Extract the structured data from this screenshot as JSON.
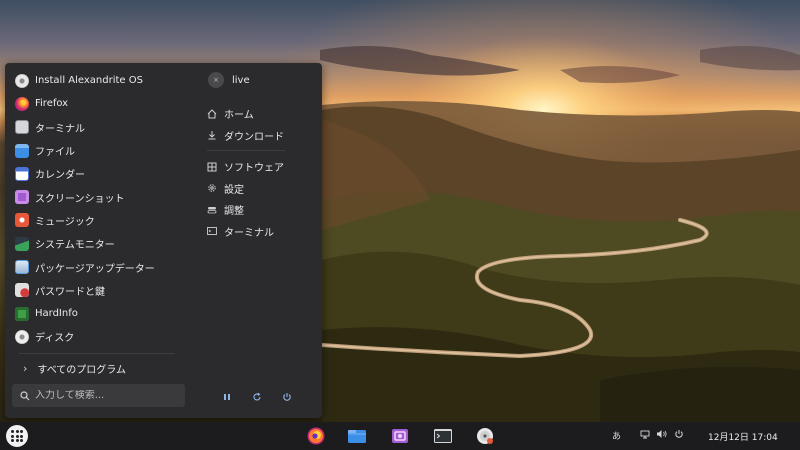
{
  "menu": {
    "apps": [
      {
        "label": "Install Alexandrite OS",
        "icon": "disc-installer-icon",
        "color": "#e8e8e8"
      },
      {
        "label": "Firefox",
        "icon": "firefox-icon",
        "color": "#ff7a2f"
      },
      {
        "label": "ターミナル",
        "icon": "terminal-icon",
        "color": "#9aa0a6"
      },
      {
        "label": "ファイル",
        "icon": "folder-icon",
        "color": "#3d8ee6"
      },
      {
        "label": "カレンダー",
        "icon": "calendar-icon",
        "color": "#4a74d6"
      },
      {
        "label": "スクリーンショット",
        "icon": "screenshot-icon",
        "color": "#a35bd1"
      },
      {
        "label": "ミュージック",
        "icon": "music-icon",
        "color": "#e8573a"
      },
      {
        "label": "システムモニター",
        "icon": "system-monitor-icon",
        "color": "#3aa35b"
      },
      {
        "label": "パッケージアップデーター",
        "icon": "package-updater-icon",
        "color": "#5e9de0"
      },
      {
        "label": "パスワードと鍵",
        "icon": "passwords-keys-icon",
        "color": "#d43c3c"
      },
      {
        "label": "HardInfo",
        "icon": "hardinfo-icon",
        "color": "#3fa04a"
      },
      {
        "label": "ディスク",
        "icon": "disks-icon",
        "color": "#cfcfcf"
      }
    ],
    "all_programs": "すべてのプログラム",
    "search_placeholder": "入力して検索...",
    "user": "live",
    "places": [
      {
        "label": "ホーム",
        "icon": "home-icon"
      },
      {
        "label": "ダウンロード",
        "icon": "download-icon"
      }
    ],
    "system": [
      {
        "label": "ソフトウェア",
        "icon": "software-icon"
      },
      {
        "label": "設定",
        "icon": "settings-icon"
      },
      {
        "label": "調整",
        "icon": "tweaks-icon"
      },
      {
        "label": "ターミナル",
        "icon": "terminal-small-icon"
      }
    ]
  },
  "taskbar": {
    "apps": [
      "firefox-icon",
      "files-icon",
      "screenshot-icon",
      "terminal-icon",
      "disc-installer-icon"
    ],
    "input_method": "あ",
    "clock": "12月12日  17:04"
  }
}
